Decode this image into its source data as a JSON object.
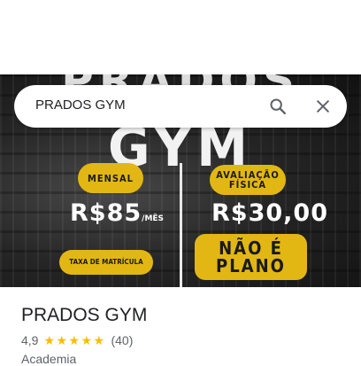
{
  "search": {
    "query": "PRADOS GYM"
  },
  "hero": {
    "headline_top": "PRADOS",
    "headline_gym": "GYM",
    "plans": {
      "mensal_label": "MENSAL",
      "mensal_price": "R$85",
      "mensal_unit": "/MÊS",
      "taxa_label": "TAXA DE MATRÍCULA",
      "avaliacao_label": "AVALIAÇÃO\nFÍSICA",
      "avaliacao_price": "R$30,00",
      "nao_e_plano": "NÃO É\nPLANO"
    }
  },
  "place": {
    "name": "PRADOS GYM",
    "rating": "4,9",
    "stars": 5,
    "review_count": "(40)",
    "category": "Academia"
  },
  "colors": {
    "accent_yellow": "#e2b714",
    "star_color": "#fbbc04"
  },
  "icons": [
    "search-icon",
    "close-icon",
    "star-icon"
  ]
}
